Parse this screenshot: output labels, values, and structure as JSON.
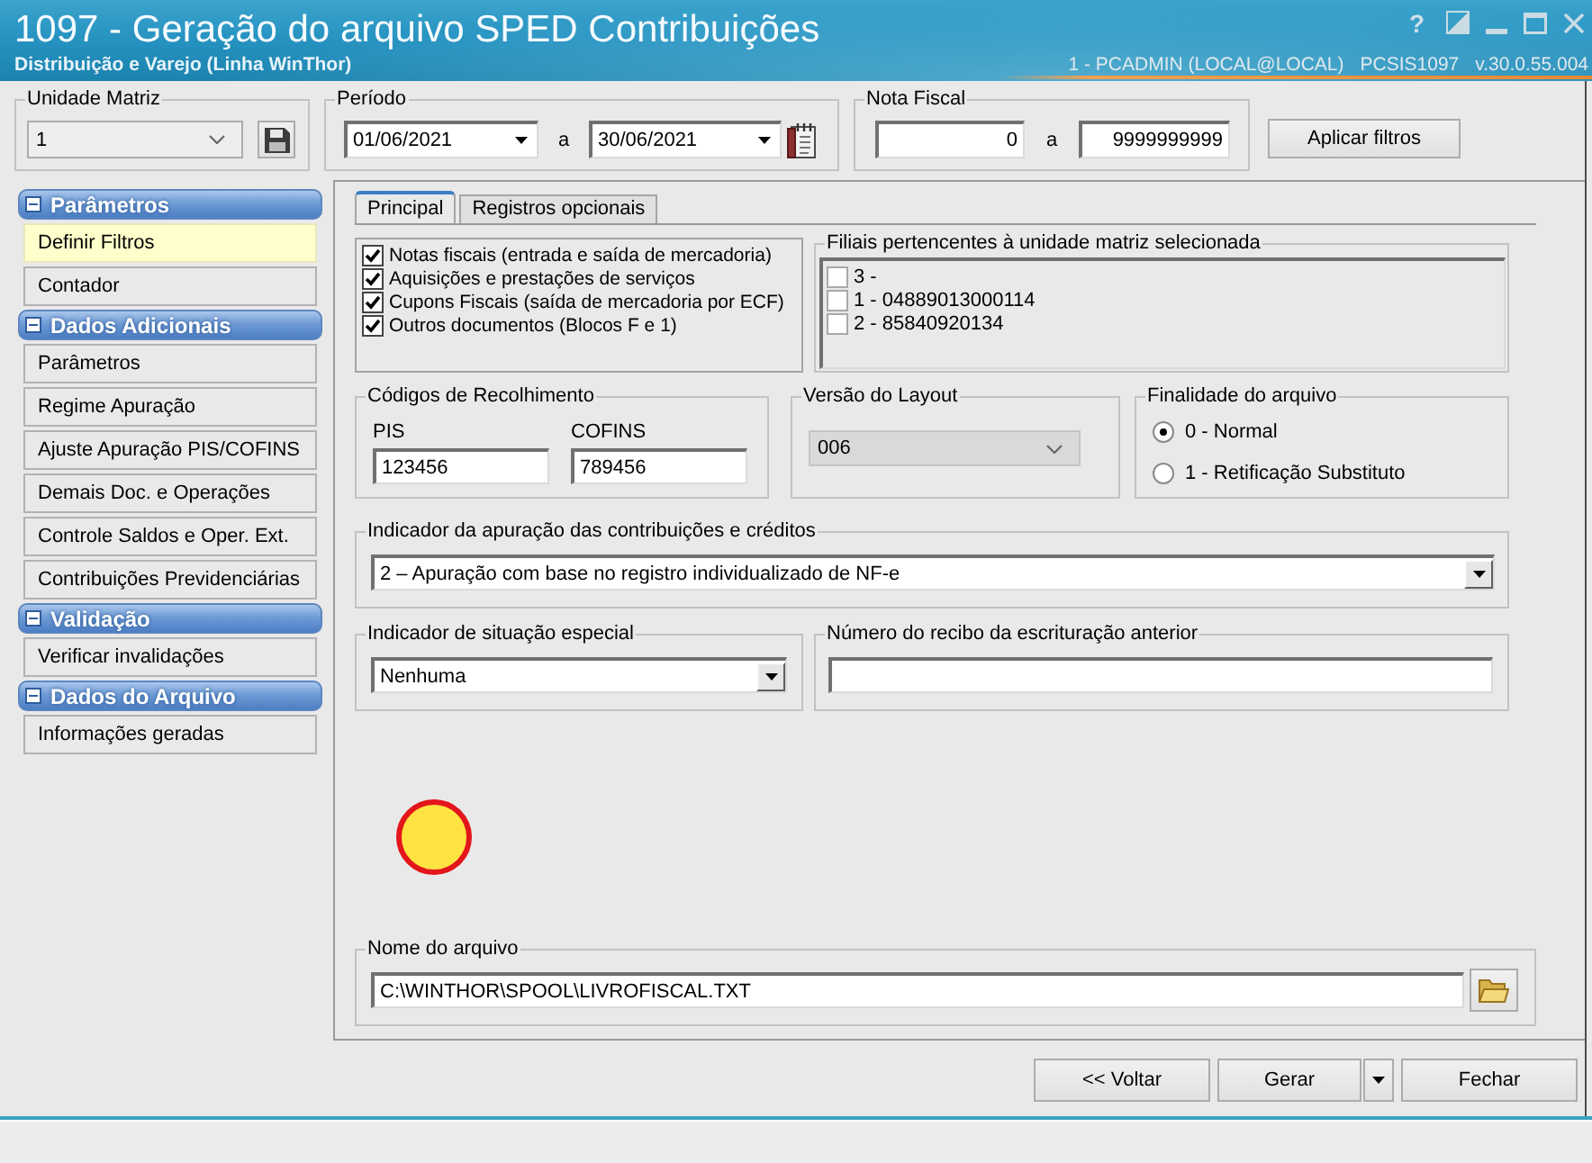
{
  "window": {
    "title": "1097 - Geração do arquivo SPED Contribuições",
    "subtitle": "Distribuição e Varejo (Linha WinThor)",
    "help": "?",
    "session": "1 - PCADMIN (LOCAL@LOCAL)",
    "program": "PCSIS1097",
    "version": "v.30.0.55.004"
  },
  "filters": {
    "unit": {
      "label": "Unidade Matriz",
      "value": "1"
    },
    "period": {
      "label": "Período",
      "start": "01/06/2021",
      "separator": "a",
      "end": "30/06/2021"
    },
    "invoice": {
      "label": "Nota Fiscal",
      "start": "0",
      "separator": "a",
      "end": "9999999999"
    },
    "apply_button": "Aplicar filtros"
  },
  "sidebar": {
    "sections": [
      {
        "title": "Parâmetros",
        "expanded": true,
        "items": [
          {
            "label": "Definir Filtros",
            "selected": true
          },
          {
            "label": "Contador",
            "selected": false
          }
        ]
      },
      {
        "title": "Dados Adicionais",
        "expanded": true,
        "items": [
          {
            "label": "Parâmetros",
            "selected": false
          },
          {
            "label": "Regime Apuração",
            "selected": false
          },
          {
            "label": "Ajuste Apuração PIS/COFINS",
            "selected": false
          },
          {
            "label": "Demais Doc. e Operações",
            "selected": false
          },
          {
            "label": "Controle Saldos e Oper. Ext.",
            "selected": false
          },
          {
            "label": "Contribuições Previdenciárias",
            "selected": false
          }
        ]
      },
      {
        "title": "Validação",
        "expanded": true,
        "items": [
          {
            "label": "Verificar invalidações",
            "selected": false
          }
        ]
      },
      {
        "title": "Dados do Arquivo",
        "expanded": true,
        "items": [
          {
            "label": "Informações geradas",
            "selected": false
          }
        ]
      }
    ]
  },
  "tabs": [
    {
      "label": "Principal",
      "selected": true
    },
    {
      "label": "Registros opcionais",
      "selected": false
    }
  ],
  "documents": [
    {
      "label": "Notas fiscais (entrada e saída de mercadoria)",
      "checked": true
    },
    {
      "label": "Aquisições e prestações de serviços",
      "checked": true
    },
    {
      "label": "Cupons Fiscais (saída de mercadoria por ECF)",
      "checked": true
    },
    {
      "label": "Outros documentos (Blocos F e 1)",
      "checked": true
    }
  ],
  "branches": {
    "label": "Filiais pertencentes à unidade matriz selecionada",
    "items": [
      {
        "label": "3 -",
        "checked": false
      },
      {
        "label": "1 - 04889013000114",
        "checked": false
      },
      {
        "label": "2 - 85840920134",
        "checked": false
      }
    ]
  },
  "collection_codes": {
    "label": "Códigos de Recolhimento",
    "fields": [
      {
        "label": "PIS",
        "value": "123456"
      },
      {
        "label": "COFINS",
        "value": "789456"
      }
    ]
  },
  "layout_version": {
    "label": "Versão do Layout",
    "value": "006",
    "disabled": true
  },
  "file_purpose": {
    "label": "Finalidade do arquivo",
    "options": [
      {
        "label": "0 - Normal",
        "selected": true
      },
      {
        "label": "1 - Retificação Substituto",
        "selected": false
      }
    ]
  },
  "calculation_indicator": {
    "label": "Indicador da apuração das contribuições e créditos",
    "value": "2 – Apuração com base no registro individualizado de NF-e"
  },
  "special_situation": {
    "label": "Indicador de situação especial",
    "value": "Nenhuma"
  },
  "previous_receipt": {
    "label": "Número do recibo da escrituração anterior"
  },
  "file_name": {
    "label": "Nome do arquivo",
    "value": "C:\\WINTHOR\\SPOOL\\LIVROFISCAL.TXT"
  },
  "buttons": [
    {
      "label": "<< Voltar",
      "kind": "plain"
    },
    {
      "label": "Gerar",
      "kind": "split"
    },
    {
      "label": "Fechar",
      "kind": "plain"
    }
  ]
}
